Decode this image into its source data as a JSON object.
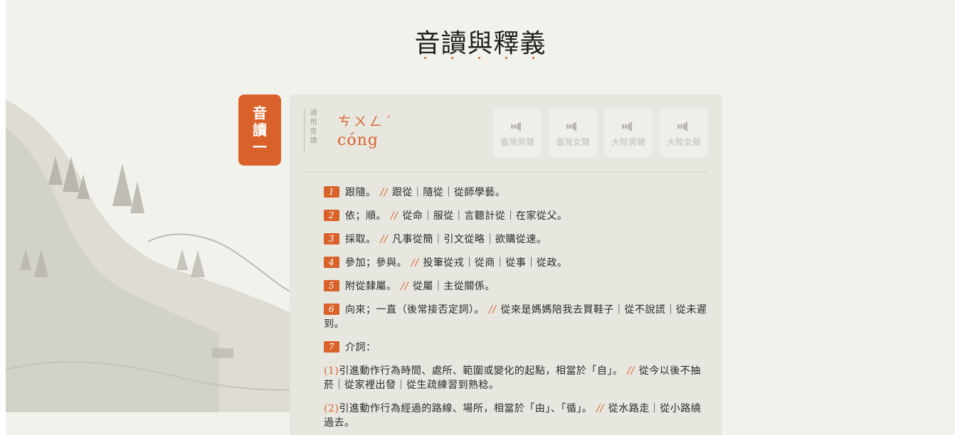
{
  "heading": {
    "title": "音讀與釋義"
  },
  "colors": {
    "accent": "#d9622b",
    "background": "#f2f2ec",
    "card": "#e7e6df"
  },
  "pronunciation_tab": {
    "chars": [
      "音",
      "讀",
      "一"
    ]
  },
  "pronunciation": {
    "label_chars": [
      "通",
      "用",
      "音",
      "讀"
    ],
    "zhuyin": "ㄘㄨㄥˊ",
    "pinyin": "cóng"
  },
  "audio_buttons": [
    {
      "label": "臺灣男聲",
      "icon": "speaker-icon"
    },
    {
      "label": "臺灣女聲",
      "icon": "speaker-icon"
    },
    {
      "label": "大陸男聲",
      "icon": "speaker-icon"
    },
    {
      "label": "大陸女聲",
      "icon": "speaker-icon"
    }
  ],
  "separator": "//",
  "definitions": [
    {
      "num": "1",
      "meaning": "跟隨。",
      "examples": "跟從｜隨從｜從師學藝。"
    },
    {
      "num": "2",
      "meaning": "依；順。",
      "examples": "從命｜服從｜言聽計從｜在家從父。"
    },
    {
      "num": "3",
      "meaning": "採取。",
      "examples": "凡事從簡｜引文從略｜欲購從速。"
    },
    {
      "num": "4",
      "meaning": "參加；參與。",
      "examples": "投筆從戎｜從商｜從事｜從政。"
    },
    {
      "num": "5",
      "meaning": "附從隸屬。",
      "examples": "從屬｜主從關係。"
    },
    {
      "num": "6",
      "meaning": "向來；一直（後常接否定詞）。",
      "examples": "從來是媽媽陪我去買鞋子｜從不說謊｜從未遲到。"
    },
    {
      "num": "7",
      "meaning": "介詞：",
      "examples": ""
    }
  ],
  "sub_definitions": [
    {
      "num": "(1)",
      "meaning": "引進動作行為時間、處所、範圍或變化的起點，相當於「自」。",
      "examples": "從今以後不抽菸｜從家裡出發｜從生疏練習到熟稔。"
    },
    {
      "num": "(2)",
      "meaning": "引進動作行為經過的路線、場所，相當於「由」、「循」。",
      "examples": "從水路走｜從小路繞過去。"
    }
  ]
}
